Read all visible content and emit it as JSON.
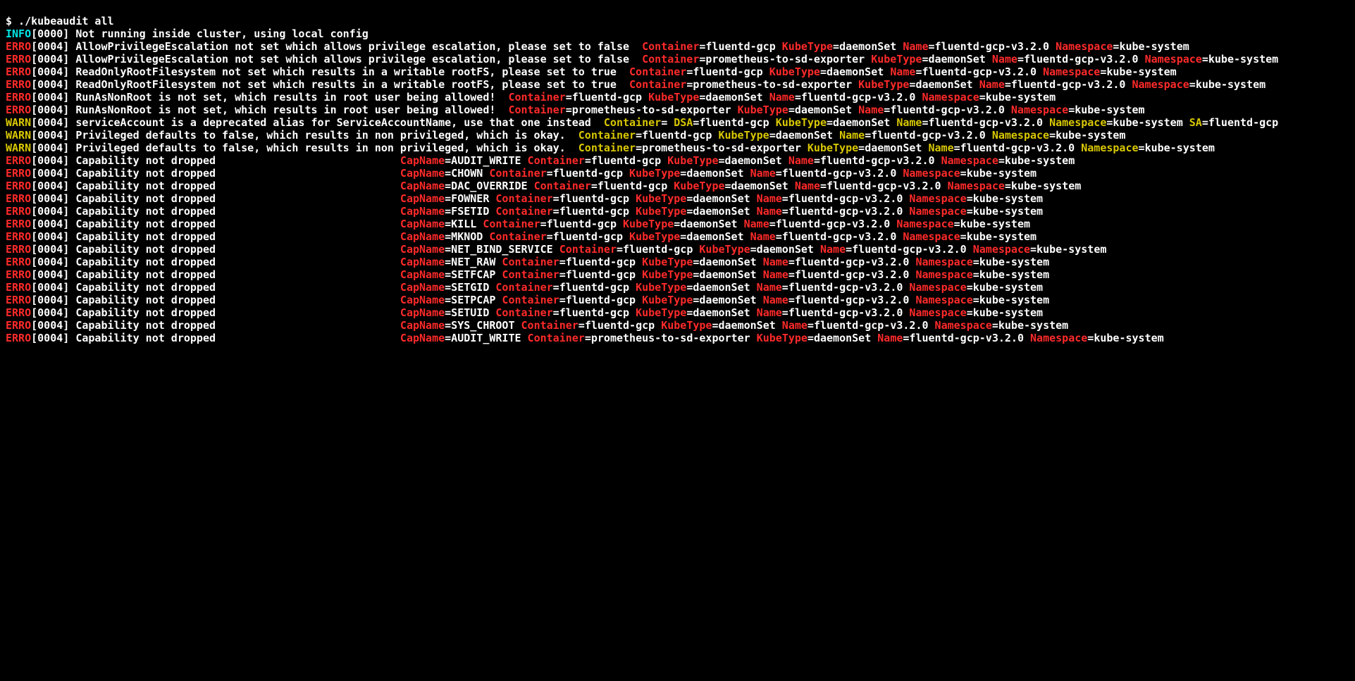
{
  "prompt": "$ ./kubeaudit all",
  "info_prefix": "INFO",
  "info_msg": "[0000] Not running inside cluster, using local config",
  "levels": {
    "ERRO": "ERRO",
    "WARN": "WARN"
  },
  "ts": "[0004] ",
  "keys": {
    "CapName": "CapName",
    "Container": "Container",
    "KubeType": "KubeType",
    "Name": "Name",
    "Namespace": "Namespace",
    "DSA": "DSA",
    "SA": "SA"
  },
  "vals": {
    "kubeType": "daemonSet",
    "ns": "kube-system",
    "name": "fluentd-gcp-v3.2.0",
    "c_fluentd": "fluentd-gcp",
    "c_prom": "prometheus-to-sd-exporter",
    "c_empty": ""
  },
  "msgs": {
    "ape": "AllowPrivilegeEscalation not set which allows privilege escalation, please set to false  ",
    "rorf": "ReadOnlyRootFilesystem not set which results in a writable rootFS, please set to true  ",
    "nonroot": "RunAsNonRoot is not set, which results in root user being allowed!  ",
    "sa_dep": "serviceAccount is a deprecated alias for ServiceAccountName, use that one instead  ",
    "priv": "Privileged defaults to false, which results in non privileged, which is okay.  ",
    "cap_pad": "Capability not dropped                             "
  },
  "caps": [
    "AUDIT_WRITE",
    "CHOWN",
    "DAC_OVERRIDE",
    "FOWNER",
    "FSETID",
    "KILL",
    "MKNOD",
    "NET_BIND_SERVICE",
    "NET_RAW",
    "SETFCAP",
    "SETGID",
    "SETPCAP",
    "SETUID",
    "SYS_CHROOT"
  ],
  "last_cap": "AUDIT_WRITE"
}
